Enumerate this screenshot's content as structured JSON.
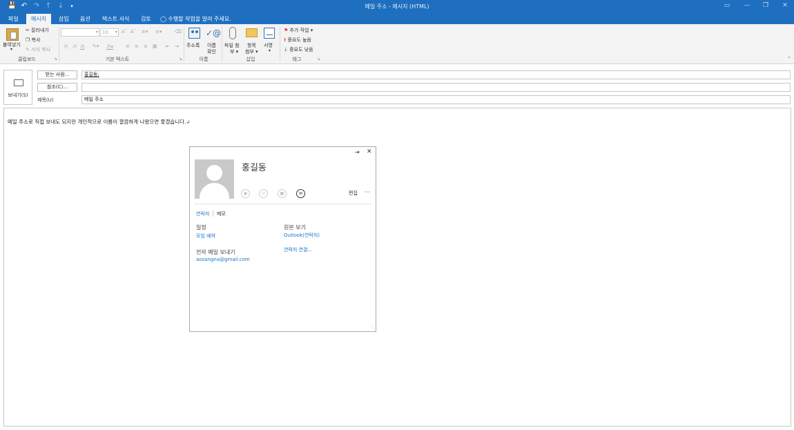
{
  "window": {
    "title": "메일 주소 - 메시지 (HTML)"
  },
  "ribbon_tabs": [
    "파일",
    "메시지",
    "삽입",
    "옵션",
    "텍스트 서식",
    "검토"
  ],
  "tell_me": "수행할 작업을 알려 주세요.",
  "clipboard": {
    "paste": "붙여넣기",
    "cut": "잘라내기",
    "copy": "복사",
    "format_painter": "서식 복사",
    "group": "클립보드"
  },
  "basic_text": {
    "font_size": "10",
    "group": "기본 텍스트"
  },
  "names": {
    "address_book": "주소록",
    "check_names_1": "이름",
    "check_names_2": "확인",
    "group": "이름"
  },
  "include": {
    "attach_file_1": "파일 첨",
    "attach_file_2": "부",
    "attach_item_1": "항목",
    "attach_item_2": "첨부",
    "signature": "서명",
    "group": "삽입"
  },
  "tags": {
    "follow_up": "추가 작업",
    "high_importance": "중요도 높음",
    "low_importance": "중요도 낮음",
    "group": "태그"
  },
  "compose": {
    "send_label": "보내기(S)",
    "to_button": "받는 사람...",
    "cc_button": "참조(C)...",
    "subject_label": "제목(U)",
    "to_value": "홍길동;",
    "cc_value": "",
    "subject_value": "메일 주소",
    "body_text": "메일 주소로 직접 보내도 되지만 개인적으로 이름이 깔끔하게 나왔으면 좋겠습니다."
  },
  "contact_card": {
    "name": "홍길동",
    "edit": "편집",
    "more": "···",
    "tabs": [
      "연락처",
      "메모"
    ],
    "schedule_heading": "일정",
    "schedule_link": "모임 예약",
    "source_heading": "원본 보기",
    "source_link": "Outlook(연락처)",
    "email_heading": "전자 메일 보내기",
    "email_value": "aozangna@gmail.com",
    "link_contacts": "연락처 연결..."
  },
  "colors": {
    "accent": "#1e6fc0",
    "link": "#1a73c8"
  }
}
